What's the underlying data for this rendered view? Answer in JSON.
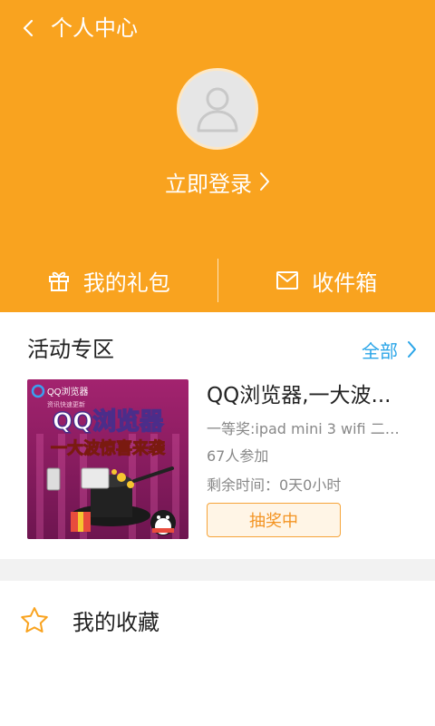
{
  "header": {
    "title": "个人中心",
    "back_icon": "chevron-left-icon",
    "avatar_icon": "user-icon",
    "login_label": "立即登录",
    "login_chevron_icon": "chevron-right-icon",
    "background_color": "#f9a31f"
  },
  "quick_actions": [
    {
      "label": "我的礼包",
      "icon": "gift-icon"
    },
    {
      "label": "收件箱",
      "icon": "mail-icon"
    }
  ],
  "activity": {
    "section_title": "活动专区",
    "all_label": "全部",
    "all_color": "#2aa5e8",
    "card": {
      "image": {
        "brand": "QQ浏览器",
        "tagline": "资讯快速更新",
        "headline": "QQ浏览器",
        "subheadline": "一大波惊喜来袭"
      },
      "title": "QQ浏览器,一大波...",
      "prize": "一等奖:ipad mini 3 wifi 二等...",
      "participants": "67人参加",
      "time_left": "剩余时间：0天0小时",
      "button_label": "抽奖中",
      "button_color": "#f39423"
    }
  },
  "favorites": {
    "label": "我的收藏",
    "icon": "star-icon"
  }
}
